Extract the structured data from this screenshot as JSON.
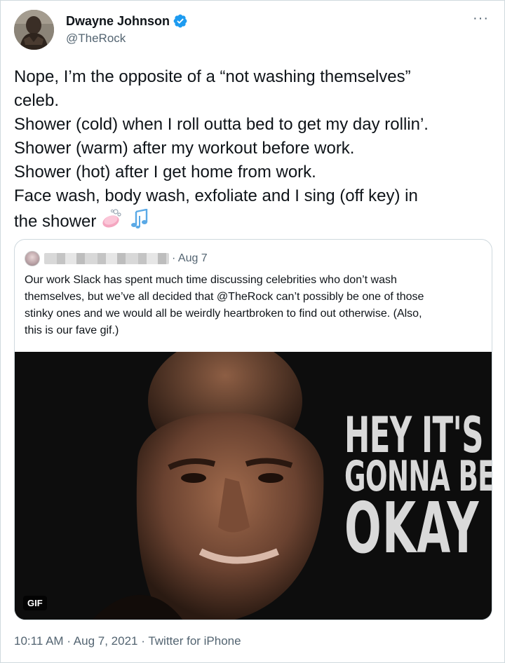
{
  "author": {
    "name": "Dwayne Johnson",
    "handle": "@TheRock",
    "verified": true
  },
  "tweet": {
    "lines": [
      "Nope, I’m the opposite of a “not washing themselves”",
      "celeb.",
      "Shower (cold) when I roll outta bed to get my day rollin’.",
      "Shower (warm) after my workout before work.",
      "Shower (hot) after I get home from work.",
      "Face wash, body wash, exfoliate and I sing (off key) in",
      "the shower"
    ],
    "emojis": [
      "soap-emoji",
      "musical-notes-emoji"
    ]
  },
  "quote": {
    "separator": "·",
    "date": "Aug 7",
    "lines": [
      "Our work Slack has spent much time discussing celebrities who don’t wash",
      "themselves, but we’ve all decided that @TheRock can’t possibly be one of those",
      "stinky ones and we would all be weirdly heartbroken to find out otherwise. (Also,",
      "this is our fave gif.)"
    ],
    "media": {
      "caption_lines": [
        "HEY IT'S",
        "GONNA BE",
        "OKAY"
      ],
      "badge": "GIF"
    }
  },
  "footer": {
    "time": "10:11 AM",
    "date": "Aug 7, 2021",
    "source": "Twitter for iPhone",
    "separator": "·"
  },
  "colors": {
    "text": "#0f1419",
    "secondary": "#536471",
    "border": "#cfd9de",
    "verified": "#1d9bf0"
  }
}
